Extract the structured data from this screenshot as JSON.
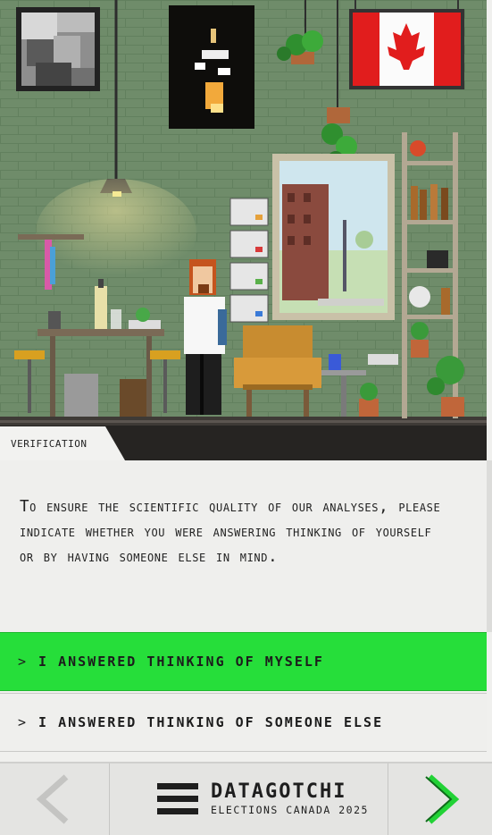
{
  "scene": {
    "section_tag": "Verification"
  },
  "question": {
    "text": "To ensure the scientific quality of our analyses, please indicate whether you were answering thinking of yourself or by having someone else in mind."
  },
  "answers": [
    {
      "label": "I answered thinking of myself",
      "selected": true
    },
    {
      "label": "I answered thinking of someone else",
      "selected": false
    }
  ],
  "bottom_bar": {
    "title": "Datagotchi",
    "subtitle": "Elections Canada 2025",
    "prev_icon": "chevron-left-icon",
    "next_icon": "chevron-right-icon",
    "menu_icon": "hamburger-menu-icon"
  },
  "colors": {
    "selected_answer": "#26de3a",
    "next_arrow": "#22d236",
    "prev_arrow_disabled": "#c4c4c2",
    "wall": "#6f8c6a"
  }
}
